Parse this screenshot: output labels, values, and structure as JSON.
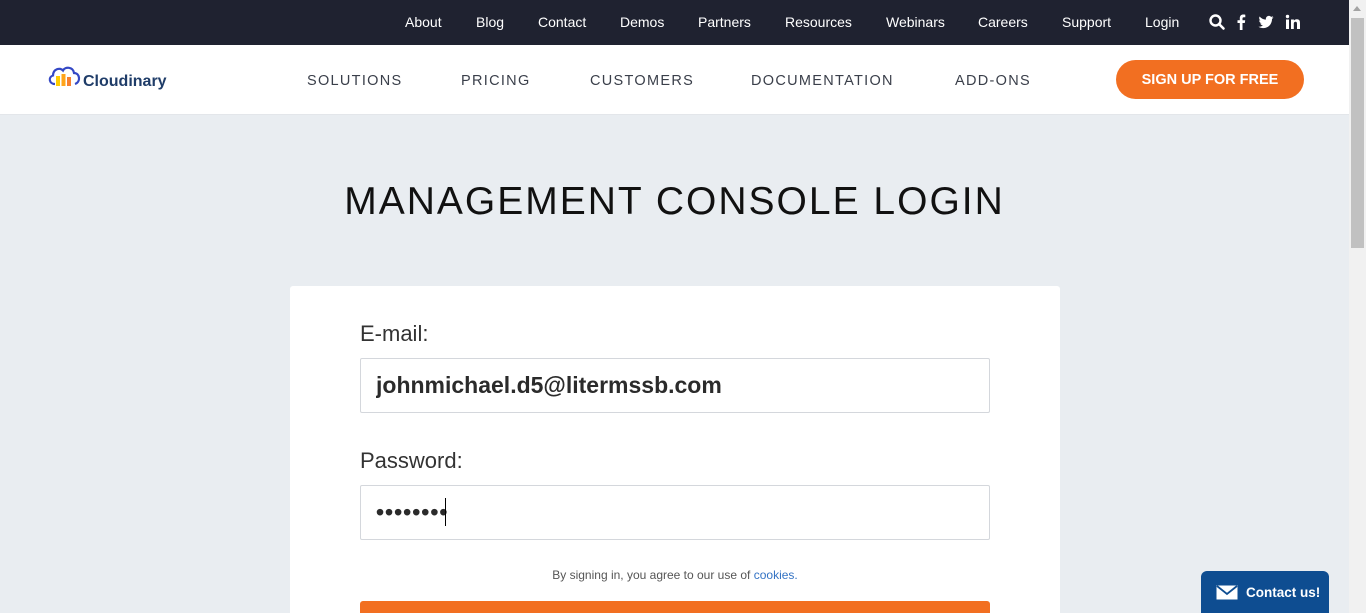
{
  "topbar": {
    "links": [
      "About",
      "Blog",
      "Contact",
      "Demos",
      "Partners",
      "Resources",
      "Webinars",
      "Careers",
      "Support",
      "Login"
    ],
    "icons": [
      "search-icon",
      "facebook-icon",
      "twitter-icon",
      "linkedin-icon"
    ]
  },
  "header": {
    "logo_text": "Cloudinary",
    "nav": [
      "SOLUTIONS",
      "PRICING",
      "CUSTOMERS",
      "DOCUMENTATION",
      "ADD-ONS"
    ],
    "cta": "SIGN UP FOR FREE"
  },
  "page": {
    "title": "MANAGEMENT CONSOLE LOGIN"
  },
  "form": {
    "email_label": "E-mail:",
    "email_value": "johnmichael.d5@litermssb.com",
    "password_label": "Password:",
    "password_value": "••••••••",
    "agree_text": "By signing in, you agree to our use of ",
    "cookies_link": "cookies."
  },
  "contact": {
    "label": "Contact us!"
  },
  "colors": {
    "accent": "#f26f21",
    "topbar_bg": "#1f2230",
    "page_bg": "#e9edf1",
    "contact_bg": "#0e4d91",
    "link": "#3473c4"
  }
}
